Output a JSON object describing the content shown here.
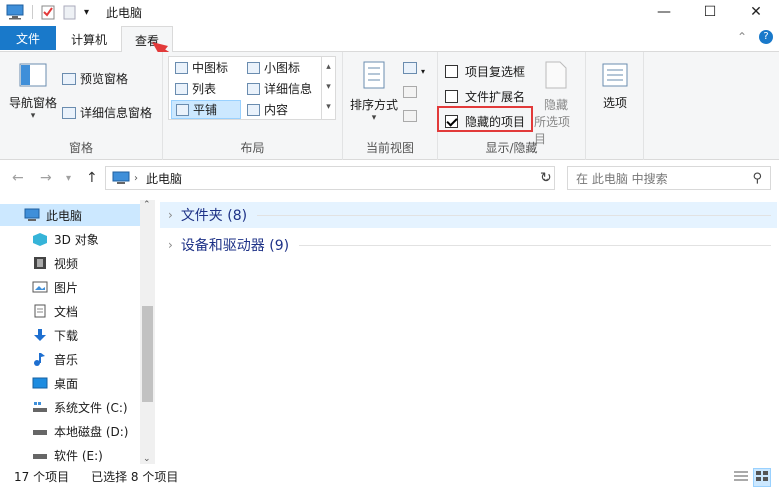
{
  "window": {
    "title": "此电脑",
    "minimize": "—",
    "maximize": "☐",
    "close": "✕"
  },
  "ribbon_tabs": {
    "file": "文件",
    "computer": "计算机",
    "view": "查看"
  },
  "ribbon": {
    "panes": {
      "nav_pane": "导航窗格",
      "preview_pane": "预览窗格",
      "details_pane": "详细信息窗格",
      "label": "窗格"
    },
    "layout": {
      "items": [
        "中图标",
        "小图标",
        "列表",
        "详细信息",
        "平铺",
        "内容"
      ],
      "label": "布局"
    },
    "current_view": {
      "sort": "排序方式",
      "label": "当前视图"
    },
    "show_hide": {
      "item_checkboxes": "项目复选框",
      "file_extensions": "文件扩展名",
      "hidden_items": "隐藏的项目",
      "hide_selected_1": "隐藏",
      "hide_selected_2": "所选项目",
      "options": "选项",
      "label": "显示/隐藏"
    }
  },
  "address": {
    "path": "此电脑",
    "search_placeholder": "在 此电脑 中搜索"
  },
  "nav_pane": {
    "items": [
      {
        "label": "此电脑"
      },
      {
        "label": "3D 对象"
      },
      {
        "label": "视频"
      },
      {
        "label": "图片"
      },
      {
        "label": "文档"
      },
      {
        "label": "下载"
      },
      {
        "label": "音乐"
      },
      {
        "label": "桌面"
      },
      {
        "label": "系统文件 (C:)"
      },
      {
        "label": "本地磁盘 (D:)"
      },
      {
        "label": "软件 (E:)"
      }
    ]
  },
  "content": {
    "groups": [
      {
        "label": "文件夹 (8)"
      },
      {
        "label": "设备和驱动器 (9)"
      }
    ]
  },
  "status": {
    "count": "17 个项目",
    "selected": "已选择 8 个项目"
  },
  "colors": {
    "accent": "#1979ca",
    "highlight": "#e23a3a"
  }
}
